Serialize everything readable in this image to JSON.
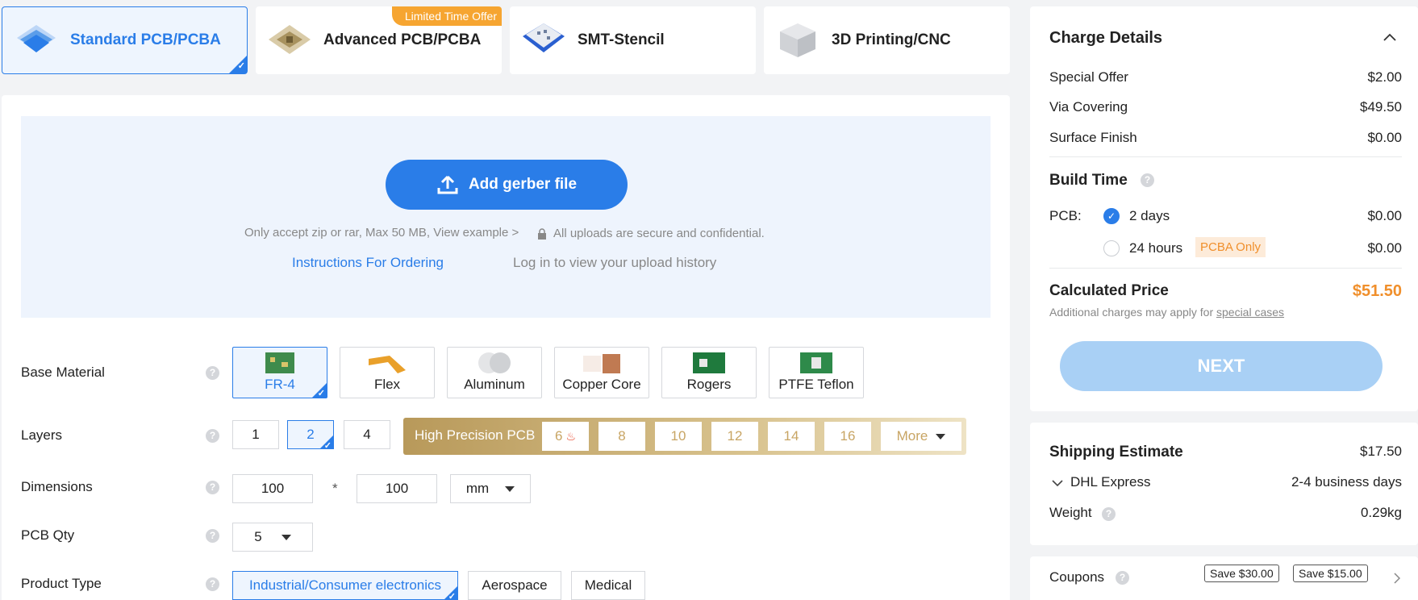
{
  "tabs": [
    {
      "label": "Standard PCB/PCBA",
      "icon": "pcb-layers-icon",
      "active": true
    },
    {
      "label": "Advanced PCB/PCBA",
      "icon": "chip-icon",
      "badge": "Limited Time Offer"
    },
    {
      "label": "SMT-Stencil",
      "icon": "stencil-icon"
    },
    {
      "label": "3D Printing/CNC",
      "icon": "cube-3d-icon"
    }
  ],
  "upload": {
    "button_label": "Add gerber file",
    "note": "Only accept zip or rar, Max 50 MB, View example >",
    "secure": "All uploads are secure and confidential.",
    "instructions_link": "Instructions For Ordering",
    "history_link": "Log in to view your upload history"
  },
  "options": {
    "base_material": {
      "label": "Base Material",
      "items": [
        "FR-4",
        "Flex",
        "Aluminum",
        "Copper Core",
        "Rogers",
        "PTFE Teflon"
      ],
      "selected": "FR-4"
    },
    "layers": {
      "label": "Layers",
      "items": [
        "1",
        "2",
        "4"
      ],
      "selected": "2",
      "high_precision_label": "High Precision PCB",
      "high_precision_items": [
        "6",
        "8",
        "10",
        "12",
        "14",
        "16"
      ],
      "more_label": "More"
    },
    "dimensions": {
      "label": "Dimensions",
      "width": "100",
      "separator": "*",
      "height": "100",
      "unit": "mm"
    },
    "pcb_qty": {
      "label": "PCB Qty",
      "value": "5"
    },
    "product_type": {
      "label": "Product Type",
      "items": [
        "Industrial/Consumer electronics",
        "Aerospace",
        "Medical"
      ],
      "selected": "Industrial/Consumer electronics"
    },
    "help_glyph": "?"
  },
  "charge": {
    "title": "Charge Details",
    "lines": [
      {
        "label": "Special Offer",
        "value": "$2.00"
      },
      {
        "label": "Via Covering",
        "value": "$49.50"
      },
      {
        "label": "Surface Finish",
        "value": "$0.00"
      }
    ],
    "build_time_title": "Build Time",
    "pcb_label": "PCB:",
    "build_options": [
      {
        "label": "2 days",
        "value": "$0.00",
        "checked": true
      },
      {
        "label": "24 hours",
        "value": "$0.00",
        "badge": "PCBA Only"
      }
    ],
    "calc_title": "Calculated Price",
    "calc_value": "$51.50",
    "calc_note": "Additional charges may apply for",
    "calc_note_link": "special cases",
    "next_label": "NEXT"
  },
  "shipping": {
    "title": "Shipping Estimate",
    "value": "$17.50",
    "carrier": "DHL Express",
    "eta": "2-4 business days",
    "weight_label": "Weight",
    "weight_value": "0.29kg"
  },
  "coupons": {
    "label": "Coupons",
    "tags": [
      "Save $30.00",
      "Save $15.00"
    ]
  },
  "colors": {
    "accent": "#2a7de8",
    "price": "#f08f2b",
    "gold": "#c8a564"
  }
}
